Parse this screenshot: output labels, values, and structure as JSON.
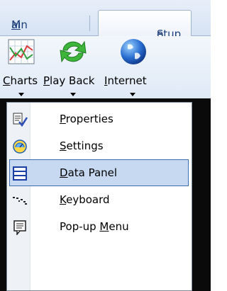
{
  "tabs": {
    "main": {
      "u": "M",
      "rest": "ain"
    },
    "setup": {
      "u": "S",
      "rest": "etup"
    }
  },
  "ribbon": [
    {
      "u": "C",
      "rest": "harts",
      "icon": "charts-icon"
    },
    {
      "u": "P",
      "rest": "lay Back",
      "icon": "play-back-icon"
    },
    {
      "u": "I",
      "rest": "nternet",
      "icon": "internet-icon"
    }
  ],
  "menu": {
    "items": [
      {
        "pre": "",
        "u": "P",
        "post": "roperties",
        "icon": "properties-icon",
        "selected": false
      },
      {
        "pre": "",
        "u": "S",
        "post": "ettings",
        "icon": "settings-icon",
        "selected": false
      },
      {
        "pre": "",
        "u": "D",
        "post": "ata Panel",
        "icon": "data-panel-icon",
        "selected": true
      },
      {
        "pre": "",
        "u": "K",
        "post": "eyboard",
        "icon": "keyboard-icon",
        "selected": false
      },
      {
        "pre": "Pop-up ",
        "u": "M",
        "post": "enu",
        "icon": "popup-menu-icon",
        "selected": false
      }
    ]
  },
  "colors": {
    "selection_bg": "#c7d9f1",
    "selection_border": "#3d6db5",
    "tab_text": "#1f3f7a"
  }
}
